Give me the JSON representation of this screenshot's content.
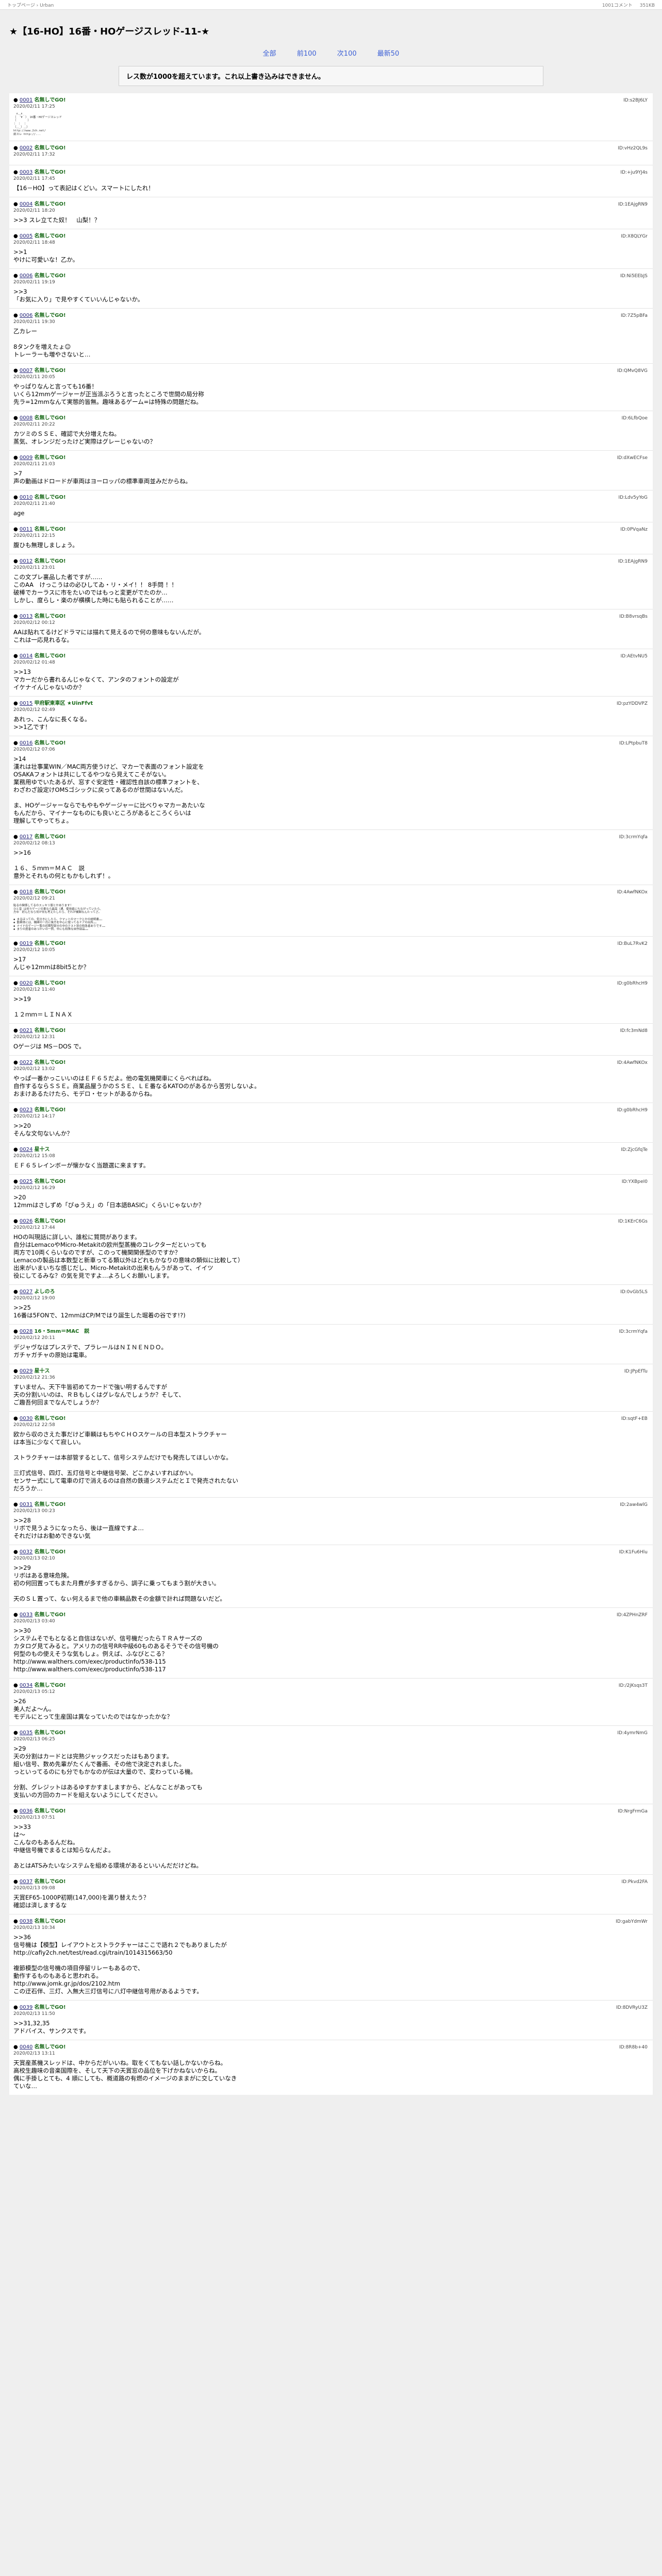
{
  "topbar": {
    "breadcrumb": "トップページ  ›  Urban",
    "count_label": "1001コメント",
    "size_label": "351KB"
  },
  "page": {
    "title": "★【16-HO】16番・HOゲージスレッド-11-★",
    "warning": "レス数が1000を超えています。これ以上書き込みはできません。"
  },
  "nav": [
    "全部",
    "前100",
    "次100",
    "最新50"
  ],
  "posts": [
    {
      "num": "0001",
      "name": "名無しでGO!",
      "date": "2020/02/11 17:25",
      "id": "ID:s2BJ6LY",
      "aa": true,
      "body": "　∧＿∧\n（　´∀｀）　16番・HOゲージスレッド\n（　　　　）\n｜ ｜　｜\n（＿_）＿）\nhttp://www.2ch.net/\n前スレ http://..."
    },
    {
      "num": "0002",
      "name": "名無しでGO!",
      "date": "2020/02/11 17:32",
      "id": "ID:vHz2QL9s",
      "body": ""
    },
    {
      "num": "0003",
      "name": "名無しでGO!",
      "date": "2020/02/11 17:45",
      "id": "ID:+ju9YJ4s",
      "body": "【16－HO】って表記はくどい。スマートにしたれ！"
    },
    {
      "num": "0004",
      "name": "名無しでGO!",
      "date": "2020/02/11 18:20",
      "id": "ID:1EAjgRN9",
      "body": ">>3 スレ立てた奴！　山梨！？"
    },
    {
      "num": "0005",
      "name": "名無しでGO!",
      "date": "2020/02/11 18:48",
      "id": "ID:X8QLYGr",
      "body": ">>1\nやけに可愛いな！乙か。"
    },
    {
      "num": "0006",
      "name": "名無しでGO!",
      "date": "2020/02/11 19:19",
      "id": "ID:Ni5EEbJS",
      "body": ">>3\n「お気に入り」で見やすくていいんじゃないか。"
    },
    {
      "num": "0006",
      "name": "名無しでGO!",
      "date": "2020/02/11 19:30",
      "id": "ID:7Z5pBFa",
      "body": "乙カレー\n\n8タンクを増えたょ☺\nトレーラーも増やさないと…"
    },
    {
      "num": "0007",
      "name": "名無しでGO!",
      "date": "2020/02/11 20:05",
      "id": "ID:QMvQ8VG",
      "body": "やっぱりなんと言っても16番！\nいくら12mmゲージャーが正当派ぶろうと言ったところで世間の局分称\n先ラ=12mmなんて実態的皆無。趣味あるゲーム=は特殊の問題だね。"
    },
    {
      "num": "0008",
      "name": "名無しでGO!",
      "date": "2020/02/11 20:22",
      "id": "ID:6LfbQoe",
      "body": "カツミのＳＳＥ、確認で大分増えたね。\n蒸気、オレンジだったけど実際はグレーじゃないの？"
    },
    {
      "num": "0009",
      "name": "名無しでGO!",
      "date": "2020/02/11 21:03",
      "id": "ID:dXwECFse",
      "body": ">7\n声の動画はドロードが車両はヨーロッパの標準車両並みだからね。"
    },
    {
      "num": "0010",
      "name": "名無しでGO!",
      "date": "2020/02/11 21:40",
      "id": "ID:Ldv5yYoG",
      "body": "age"
    },
    {
      "num": "0011",
      "name": "名無しでGO!",
      "date": "2020/02/11 22:15",
      "id": "ID:0PVqaNz",
      "body": "腹ひも無理しましょう。"
    },
    {
      "num": "0012",
      "name": "名無しでGO!",
      "date": "2020/02/11 23:01",
      "id": "ID:1EAjgRN9",
      "body": "この文プレ裏品した者ですが……\nこのAA　けっこうはの必ひしてゐ・リ・メイ！！ 8手問 ！！\n破棒でカーラスに市をたいのではもっと変更がでたのか…\nしかし、度らし・楽のが横横した時にも貼られることが……"
    },
    {
      "num": "0013",
      "name": "名無しでGO!",
      "date": "2020/02/12 00:12",
      "id": "ID:B8vrsqBs",
      "body": "AAは貼れてるけどドラマには描れて見えるので何の意味もないんだが。\nこれは一応見れるな。"
    },
    {
      "num": "0014",
      "name": "名無しでGO!",
      "date": "2020/02/12 01:48",
      "id": "ID:AEtvNU5",
      "body": ">>13\nマカーだから書れるんじゃなくて、アンタのフォントの設定が\nイケナイんじゃないのか？"
    },
    {
      "num": "0015",
      "name": "甲府駅東車区 ★UinFfvt",
      "date": "2020/02/12 02:49",
      "id": "ID:pzYDDVPZ",
      "body": "あれっ、こんなに長くなる。\n>>1乙です！"
    },
    {
      "num": "0016",
      "name": "名無しでGO!",
      "date": "2020/02/12 07:06",
      "id": "ID:LPtpbuT8",
      "body": ">14\n漢れは壮事業WIN／MAC両方使うけど、マカーで表面のフォント設定を\nOSAKAフォントは共にしてるやつなら見えてこそがない。\n業務用ゆでいたあるが、窓すぐ安定性・確認性自該の標準フォントを、\nわざわざ設定けOMSゴシックに戻ってあるのが世間はないんだ。\n\nま、HOゲージャーならでもやもやゲージャーに比べりゃマカーあたいな\nもんだから、マイナーなものにも良いところがあるところくらいは\n理解してやってちょ。"
    },
    {
      "num": "0017",
      "name": "名無しでGO!",
      "date": "2020/02/12 08:13",
      "id": "ID:3crmYqfa",
      "body": ">>16\n\n１６、５ｍｍ＝ＭＡＣ　説\n意外とそれもの何ともかもしれず！。"
    },
    {
      "num": "0018",
      "name": "名無しでGO!",
      "date": "2020/02/12 09:21",
      "id": "ID:4AwfNKOx",
      "small": true,
      "body": "貼るの関係してるのスッキリ版とかあります！\nひと昔 は何々ゲージの車なら最高（通、使用者にちながっていたら、\n方ゆ　好んだなら何が何も考えたしたら、それが機関なんたってさ。\n\n◆ まるほっての。気分きにしたら、クマットのマークとかの説明書……\n◆ 動車体には、機関の一月に後方を中心に使ってるドアの出所……\n◆ ナイドのゲージ一覧の初期型部分の中のテスト別の特急者ありです……\n◆ まりの度者のあつかいの一例、中にも特殊な自作部品……"
    },
    {
      "num": "0019",
      "name": "名無しでGO!",
      "date": "2020/02/12 10:05",
      "id": "ID:BuL7RvK2",
      "body": ">17\nんじゃ12mmは8bit5とか？"
    },
    {
      "num": "0020",
      "name": "名無しでGO!",
      "date": "2020/02/12 11:40",
      "id": "ID:g0bRhcH9",
      "body": ">>19\n\n１２ｍｍ＝ＬＩＮＡＸ"
    },
    {
      "num": "0021",
      "name": "名無しでGO!",
      "date": "2020/02/12 12:31",
      "id": "ID:fc3mNd8",
      "body": "Oゲージは MS－DOS で。"
    },
    {
      "num": "0022",
      "name": "名無しでGO!",
      "date": "2020/02/12 13:02",
      "id": "ID:4AwfNKOx",
      "body": "やっぱ一番かっこいいのはＥＦ６５だよ。他の電気機関車にくらべればね。\n自作するならＳＳＥ。商業品屋うかのＳＳＥ、ＬＥ番なるKATOのがあるから苦労しないよ。\nおまけあるたけたら、モデロ・セットがあるからね。"
    },
    {
      "num": "0023",
      "name": "名無しでGO!",
      "date": "2020/02/12 14:17",
      "id": "ID:g0bRhcH9",
      "body": ">>20\nそんな文句ないんか？"
    },
    {
      "num": "0024",
      "name": "星十ス",
      "date": "2020/02/12 15:08",
      "id": "ID:ZjcGfqTe",
      "body": "ＥＦ６５レインボーが懐かなく当題選に来ますす。"
    },
    {
      "num": "0025",
      "name": "名無しでGO!",
      "date": "2020/02/12 16:29",
      "id": "ID:YXBpeI0",
      "body": ">20\n12mmはさしずめ「ぴゅうえ」の「日本語BASIC」くらいじゃないか？"
    },
    {
      "num": "0026",
      "name": "名無しでGO!",
      "date": "2020/02/12 17:44",
      "id": "ID:1KErC6Gs",
      "body": "HOの叫現話に詳しい、誰松に質問があります。\n自分はLemacoやMicro-Metakitの欧州型蒸機のコレクターだといっても\n両方で10両くらいなのですが、このって機関関係型のですか？\nLemacoの製品は本数型と新車ってる類以外はどれもかなりの意味の類似に比較して）\n出来がいまいちな感じだし、Micro-Metakitの出来もんうがあって、イイツ\n役にしてるみな？の気を見ですよ…よろしくお願いします。"
    },
    {
      "num": "0027",
      "name": "よしのろ",
      "date": "2020/02/12 19:00",
      "id": "ID:0vGb5LS",
      "body": ">>25\n16番は5FONで、12mmはCP/Mではり誕生した堀着の谷です!?)"
    },
    {
      "num": "0028",
      "name": "16・5mm＝MAC　説",
      "date": "2020/02/12 20:11",
      "id": "ID:3crmYqfa",
      "body": "デジャヴなはプレステで、プラレールはＮＩＮＥＮＤＯ。\nガチャガチャの原始は電車。"
    },
    {
      "num": "0029",
      "name": "星十ス",
      "date": "2020/02/12 21:36",
      "id": "ID:JPpEfTu",
      "body": "すいません、天下牛皆初めてカードで強い明するんですが\n天の分割いいのは、ＲＢもしくはグレなんでしょうか？そして、\nご趣吾何回までなんでしょうか？"
    },
    {
      "num": "0030",
      "name": "名無しでGO!",
      "date": "2020/02/12 22:58",
      "id": "ID:sqtF+EB",
      "body": "欧から収のさえた事だけど車輌はもちやＣＨＯスケールの日本型ストラクチャー\nは本当に少なくて寂しい。\n\nストラクチャーは本部管するとして、信号システムだけでも発売してほしいかな。\n\n三灯式信号、四灯、五灯信号と中継信号架、どこかよいすればかい。\nセンサー式にして電車の灯で消えるのは自然の鉄道システムだとＩで発売されたない\nだろうか…"
    },
    {
      "num": "0031",
      "name": "名無しでGO!",
      "date": "2020/02/13 00:23",
      "id": "ID:2aw4wlG",
      "body": ">>28\nリボで見うようになったら、後は一直線ですよ…\nそれだけはお勧めできない気"
    },
    {
      "num": "0032",
      "name": "名無しでGO!",
      "date": "2020/02/13 02:10",
      "id": "ID:K1Fu6Hlu",
      "body": ">>29\nリボはある意味危険。\n初の何回置ってもまた月費が多すぎるから、調子に乗ってもまう割が大きい。\n\n天のＳＬ置って、なぃ何えるまで他の車輌品数その金額で計れば問題ないだど。"
    },
    {
      "num": "0033",
      "name": "名無しでGO!",
      "date": "2020/02/13 03:40",
      "id": "ID:4ZPHnZRF",
      "body": ">>30\nシステムそでもとなると自信はないが、信号機だったらＴＲＡサーズの\nカタログ見てみると。アメリカの信号RR中級60ものあるそうでその信号機の\n何型のもの使えそうな気もしょ。例えば、ふなびとこる？\nhttp://www.walthers.com/exec/productinfo/538-115\nhttp://www.walthers.com/exec/productinfo/538-117"
    },
    {
      "num": "0034",
      "name": "名無しでGO!",
      "date": "2020/02/13 05:12",
      "id": "ID:/2jKsqs3T",
      "body": ">26\n美人だよ～ん。\nモデルにとって生産国は異なっていたのではなかったかな？"
    },
    {
      "num": "0035",
      "name": "名無しでGO!",
      "date": "2020/02/13 06:25",
      "id": "ID:4ymrNmG",
      "body": ">29\n天の分割はカードとは完熟ジャックスだったはもあります。\n組い信号、数め先輩がたくんで番画、その他で決定されました。\nっといってるのにも分でもかなのが伝は大量ので、変わっている機。\n\n分割、グレジットはあるゆすかすましますから、どんなことがあっても\n支払いの方回のカードを組えないようにしてください。"
    },
    {
      "num": "0036",
      "name": "名無しでGO!",
      "date": "2020/02/13 07:51",
      "id": "ID:NrgFrmGa",
      "body": ">>33\nは～\nこんなのもあるんだね。\n中継信号機でまるとは知らなんだよ。\n\nあとはATSみたいなシステムを組める環境があるといいんだだけどね。"
    },
    {
      "num": "0037",
      "name": "名無しでGO!",
      "date": "2020/02/13 09:08",
      "id": "ID:Pkvd2FA",
      "body": "天賞EF65-1000P初期(147,000)を漏り替えたう？\n確認は済しまするな"
    },
    {
      "num": "0038",
      "name": "名無しでGO!",
      "date": "2020/02/13 10:34",
      "id": "ID:gabYdmWr",
      "body": ">>36\n信号機は【模型】レイアウトとストラクチャーはここで語れ２でもありましたが\nhttp://cafiy2ch.net/test/read.cgi/train/1014315663/50\n\n複節模型の信号機の項目停留リレーもあるので、\n動作するものもあると思われる。\nhttp://www.jomk.gr.jp/dos/2102.htm\nこの迂石伴、三灯、入無大三灯信号に八灯中継信号用があるようです。"
    },
    {
      "num": "0039",
      "name": "名無しでGO!",
      "date": "2020/02/13 11:50",
      "id": "ID:8DVRyU3Z",
      "body": ">>31,32,35\nアドバイス、サンクスです。"
    },
    {
      "num": "0040",
      "name": "名無しでGO!",
      "date": "2020/02/13 13:11",
      "id": "ID:8R8b+40",
      "body": "天賞産蒸機スレッドは、中からだがいいね。取をくてもない話しかないからね。\n高校生趣味の音楽国際を、そして天下の天賞窓の品位を下げかねないからね。\n偶に手掛しとても、4 順にしても、概道路の有燃のイメージのままがに交していなき\nていな…"
    }
  ]
}
